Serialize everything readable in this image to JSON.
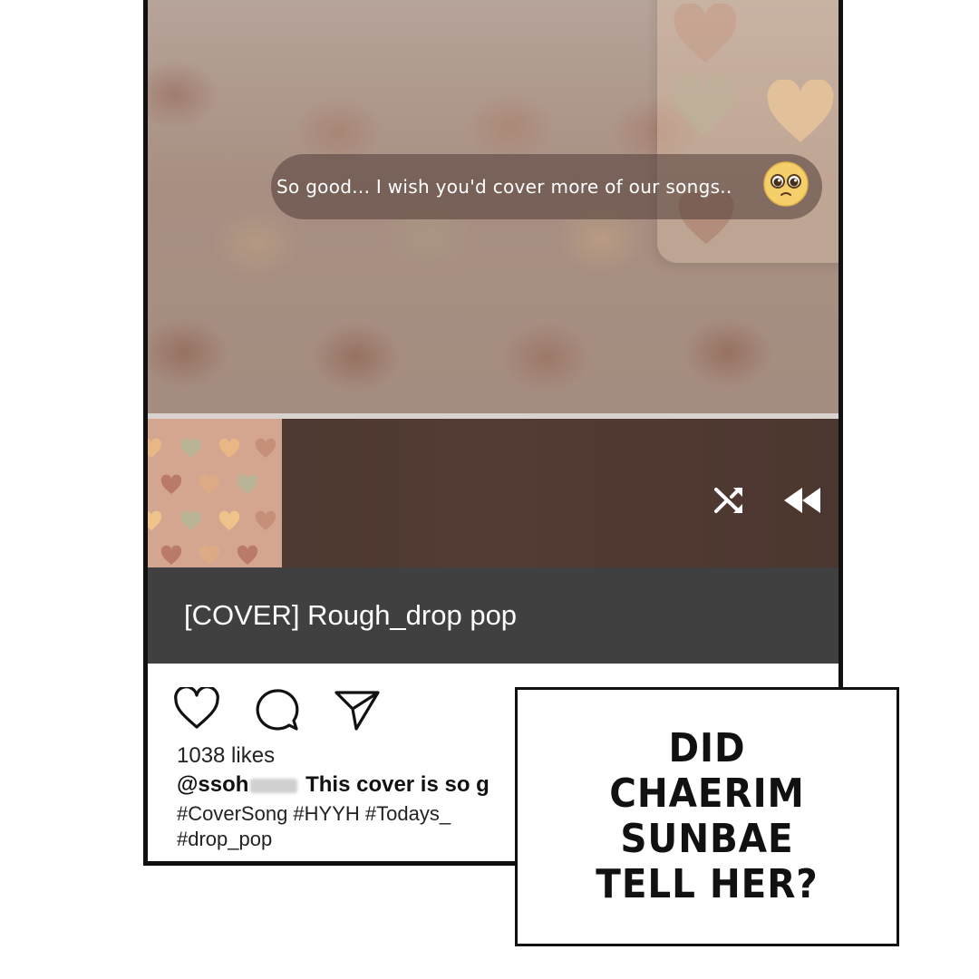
{
  "video": {
    "comment": "So good... I wish you'd cover more of our songs..",
    "emoji": "pleading-face-emoji"
  },
  "player": {
    "song_title": "[COVER] Rough_drop pop",
    "controls": [
      "shuffle-icon",
      "rewind-icon"
    ]
  },
  "post": {
    "likes": "1038 likes",
    "username": "@ssoh",
    "caption_visible": "This cover is so g",
    "hashtags_line1": "#CoverSong #HYYH #Todays_",
    "hashtags_line2": "#drop_pop"
  },
  "speech_bubble": {
    "text": "DID CHAERIM SUNBAE TELL HER?"
  },
  "colors": {
    "title_bar": "#414040",
    "queue_bg": "#4a3831",
    "video_bg": "#a88f82"
  }
}
